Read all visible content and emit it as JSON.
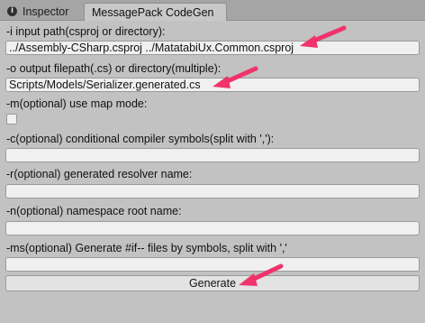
{
  "tabs": [
    {
      "label": "Inspector",
      "icon": "info-icon",
      "active": false
    },
    {
      "label": "MessagePack CodeGen",
      "active": true
    }
  ],
  "form": {
    "input_label": "-i input path(csproj or directory):",
    "input_value": "../Assembly-CSharp.csproj ../MatatabiUx.Common.csproj",
    "output_label": "-o output filepath(.cs) or directory(multiple):",
    "output_value": "Scripts/Models/Serializer.generated.cs",
    "map_label": "-m(optional) use map mode:",
    "map_checked": false,
    "conditional_label": "-c(optional) conditional compiler symbols(split with ','):",
    "conditional_value": "",
    "resolver_label": "-r(optional) generated resolver name:",
    "resolver_value": "",
    "namespace_label": "-n(optional) namespace root name:",
    "namespace_value": "",
    "ms_label": "-ms(optional) Generate #if-- files by symbols, split with ','",
    "ms_value": ""
  },
  "generate_button": "Generate",
  "colors": {
    "annotation_arrow": "#f0336b",
    "window_bg": "#c2c2c2",
    "field_bg": "#f0f0f0"
  }
}
